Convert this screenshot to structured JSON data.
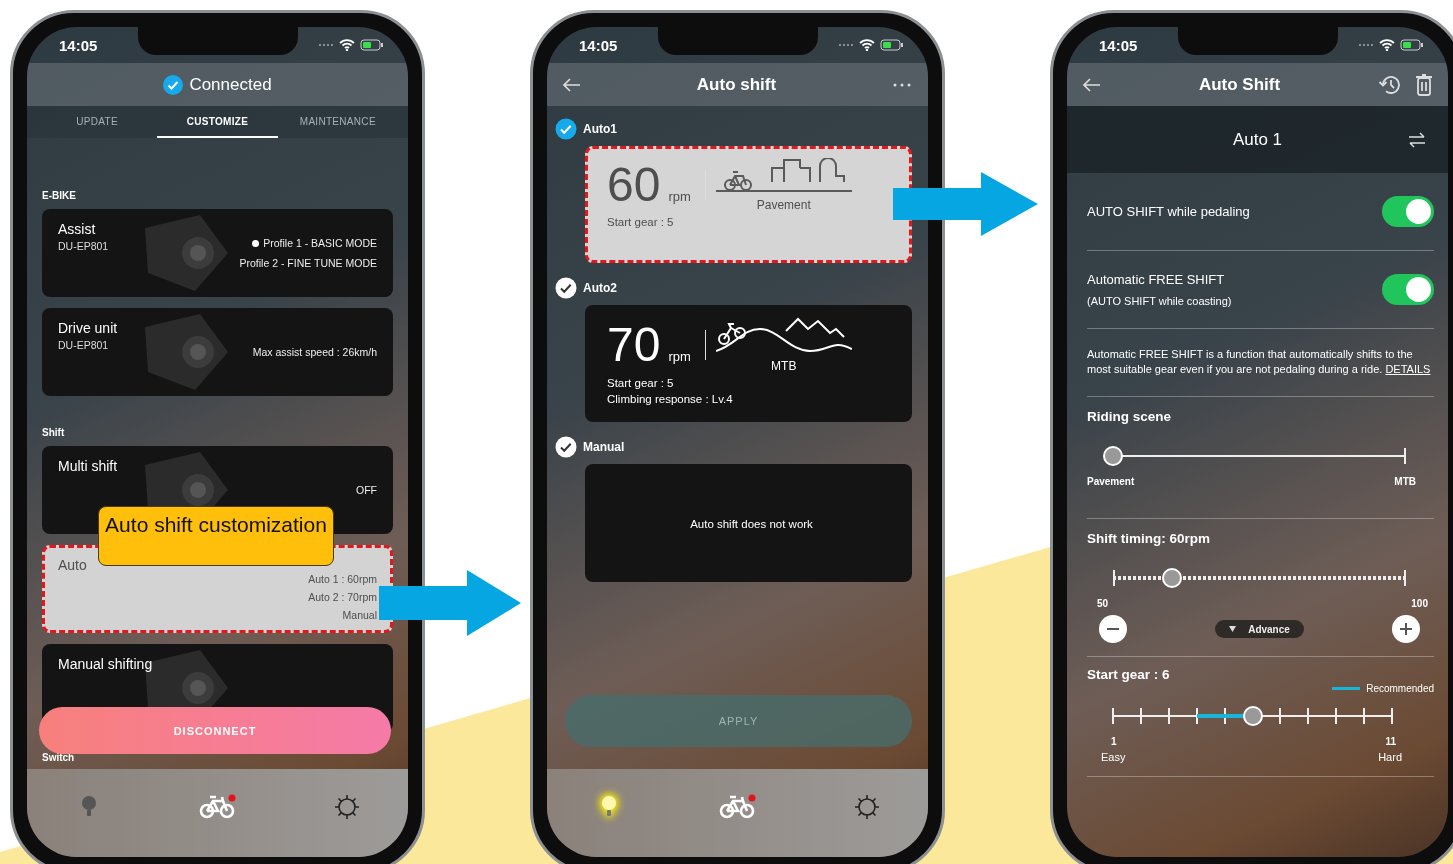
{
  "customize_screen": {
    "time": "14:05",
    "header": "Connected",
    "tabs": [
      {
        "label": "UPDATE",
        "selected": false
      },
      {
        "label": "CUSTOMIZE",
        "selected": true
      },
      {
        "label": "MAINTENANCE",
        "selected": false
      }
    ],
    "sections": [
      {
        "heading": "E-BIKE",
        "cards": [
          {
            "kind": "profiles",
            "title": "Assist",
            "subtitle": "DU-EP801",
            "highlighted": false,
            "profiles": [
              {
                "label": "Profile 1 - BASIC MODE",
                "selected": true
              },
              {
                "label": "Profile 2 - FINE TUNE MODE",
                "selected": false
              }
            ]
          },
          {
            "kind": "lines",
            "title": "Drive unit",
            "subtitle": "DU-EP801",
            "highlighted": false,
            "lines": [
              "Max assist speed : 26km/h"
            ]
          }
        ]
      },
      {
        "heading": "Shift",
        "cards": [
          {
            "kind": "lines",
            "title": "Multi shift",
            "highlighted": false,
            "lines": [
              "OFF"
            ]
          },
          {
            "kind": "lines",
            "title": "Auto",
            "highlighted": true,
            "lines": [
              "Auto 1 : 60rpm",
              "Auto 2 : 70rpm",
              "Manual"
            ]
          },
          {
            "kind": "lines",
            "title": "Manual shifting",
            "highlighted": false
          }
        ]
      },
      {
        "heading": "Switch"
      }
    ],
    "button": "DISCONNECT",
    "tabbar": [
      {
        "kind": "bulb",
        "on": false
      },
      {
        "kind": "bike",
        "badge": true
      },
      {
        "kind": "gear"
      }
    ]
  },
  "callout": "Auto shift customization",
  "auto_shift_screen": {
    "time": "14:05",
    "title": "Auto shift",
    "options": [
      {
        "kind": "pavement",
        "label": "Auto1",
        "selected": true,
        "highlighted": true,
        "rpm": "60",
        "unit": "rpm",
        "scene": "Pavement",
        "lines": [
          "Start gear : 5"
        ]
      },
      {
        "kind": "mtb",
        "label": "Auto2",
        "selected": false,
        "highlighted": false,
        "rpm": "70",
        "unit": "rpm",
        "scene": "MTB",
        "lines": [
          "Start gear : 5",
          "Climbing response : Lv.4"
        ]
      },
      {
        "kind": "manual",
        "label": "Manual",
        "selected": false,
        "highlighted": false,
        "message": "Auto shift does not work"
      }
    ],
    "button": {
      "label": "APPLY",
      "disabled": true
    },
    "tabbar": [
      {
        "kind": "bulb",
        "on": true
      },
      {
        "kind": "bike",
        "badge": true
      },
      {
        "kind": "gear"
      }
    ]
  },
  "detail_screen": {
    "time": "14:05",
    "title": "Auto Shift",
    "profile": "Auto 1",
    "toggles": [
      {
        "label": "AUTO SHIFT while pedaling",
        "on": true
      },
      {
        "label": "Automatic FREE SHIFT",
        "sublabel": "(AUTO SHIFT while coasting)",
        "on": true
      }
    ],
    "note": "Automatic FREE SHIFT is a function that automatically shifts to the most suitable gear even if you are not pedaling during a ride.",
    "note_link": "DETAILS",
    "riding_scene": {
      "title": "Riding scene",
      "level": 0,
      "min_label": "Pavement",
      "max_label": "MTB"
    },
    "shift_timing": {
      "title": "Shift timing: 60rpm",
      "level": 0.2,
      "min_label": "50",
      "max_label": "100",
      "advance": "Advance"
    },
    "start_gear": {
      "title": "Start gear : 6",
      "legend": "Recommended",
      "level": 0.5,
      "min_label": "1",
      "max_label": "11",
      "easy": "Easy",
      "hard": "Hard"
    }
  }
}
